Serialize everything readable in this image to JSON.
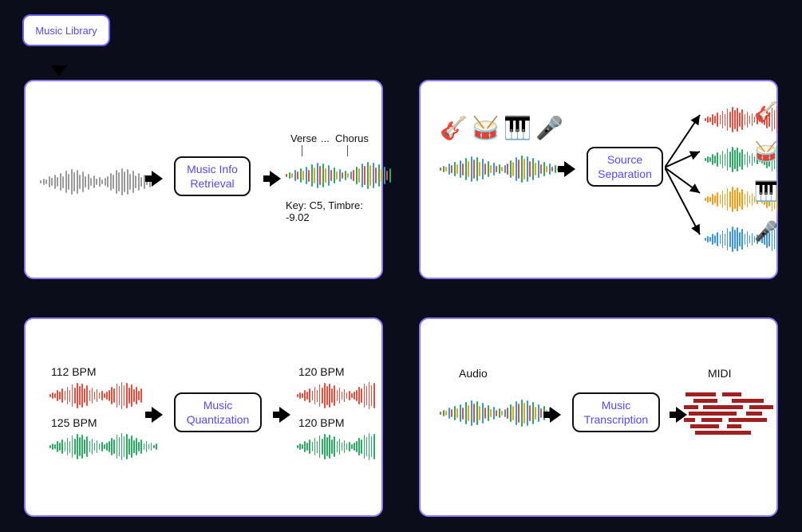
{
  "library": {
    "label": "Music Library"
  },
  "cards": {
    "mir": {
      "proc": "Music Info\nRetrieval",
      "verse": "Verse",
      "ellip": "...",
      "chorus": "Chorus",
      "meta": "Key: C5, Timbre: -9.02"
    },
    "sep": {
      "proc": "Source\nSeparation"
    },
    "quant": {
      "proc": "Music\nQuantization",
      "in1": "112 BPM",
      "in2": "125 BPM",
      "out1": "120 BPM",
      "out2": "120 BPM"
    },
    "trans": {
      "proc": "Music\nTranscription",
      "audio": "Audio",
      "midi": "MIDI"
    }
  },
  "colors": {
    "grey": "#9a9a9a",
    "red": "#e74c3c",
    "green": "#27ae60",
    "orange": "#f39c12",
    "blue": "#3498db"
  },
  "wave_heights": [
    4,
    8,
    6,
    14,
    10,
    18,
    12,
    22,
    15,
    28,
    20,
    32,
    24,
    30,
    18,
    26,
    14,
    20,
    10,
    16,
    8,
    12,
    6,
    10,
    14,
    22,
    18,
    30,
    24,
    34,
    26,
    32,
    20,
    28,
    16,
    22,
    12,
    18,
    8,
    14,
    6,
    10,
    4,
    8
  ]
}
